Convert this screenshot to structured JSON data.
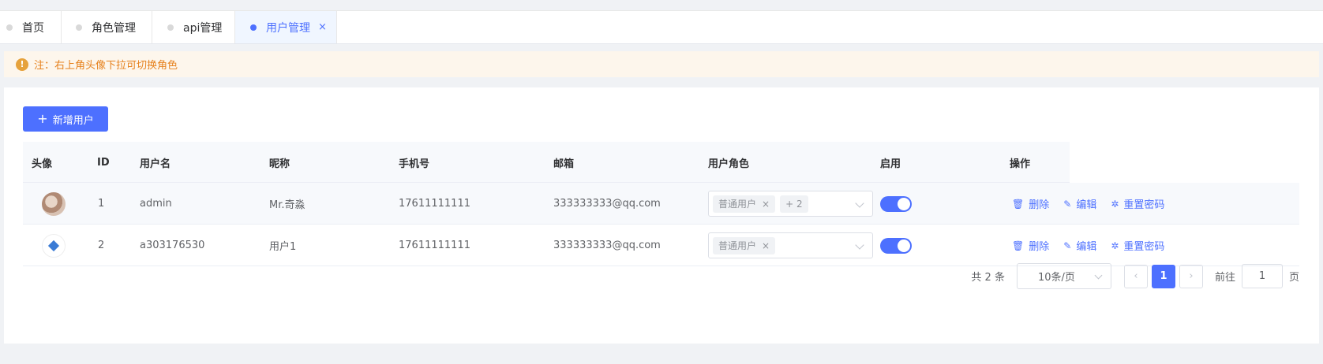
{
  "tabs": [
    {
      "label": "首页",
      "active": false
    },
    {
      "label": "角色管理",
      "active": false
    },
    {
      "label": "api管理",
      "active": false
    },
    {
      "label": "用户管理",
      "active": true,
      "close": "×"
    }
  ],
  "notice": {
    "icon": "!",
    "text": "注：右上角头像下拉可切换角色"
  },
  "toolbar": {
    "add_label": "新增用户",
    "add_icon": "+"
  },
  "table": {
    "headers": [
      "头像",
      "ID",
      "用户名",
      "昵称",
      "手机号",
      "邮箱",
      "用户角色",
      "启用",
      "操作"
    ],
    "rows": [
      {
        "avatar": "avatar-photo",
        "id": "1",
        "username": "admin",
        "nickname": "Mr.奇淼",
        "phone": "17611111111",
        "email": "333333333@qq.com",
        "roles": [
          "普通用户"
        ],
        "roles_extra": "+ 2",
        "enabled": true,
        "actions": {
          "delete": "删除",
          "edit": "编辑",
          "reset": "重置密码"
        }
      },
      {
        "avatar": "avatar-logo",
        "id": "2",
        "username": "a303176530",
        "nickname": "用户1",
        "phone": "17611111111",
        "email": "333333333@qq.com",
        "roles": [
          "普通用户"
        ],
        "roles_extra": "",
        "enabled": true,
        "actions": {
          "delete": "删除",
          "edit": "编辑",
          "reset": "重置密码"
        }
      }
    ]
  },
  "pagination": {
    "total": "共 2 条",
    "page_size": "10条/页",
    "current_page": "1",
    "goto_label": "前往",
    "goto_value": "1",
    "page_suffix": "页",
    "prev_icon": "‹",
    "next_icon": "›"
  },
  "colors": {
    "accent": "#4d70ff",
    "warning": "#e6a23c",
    "warning_bg": "#fdf6ec"
  }
}
